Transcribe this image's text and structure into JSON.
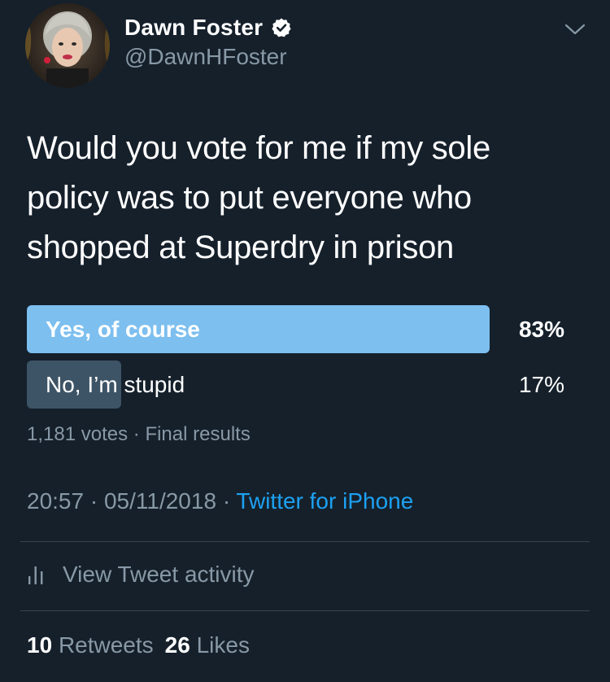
{
  "tweet": {
    "author": {
      "display_name": "Dawn Foster",
      "handle": "@DawnHFoster",
      "verified": true
    },
    "text": "Would you vote for me if my sole policy was to put everyone who shopped at Superdry in prison"
  },
  "poll": {
    "options": [
      {
        "label": "Yes, of course",
        "percent_text": "83%",
        "percent": 83,
        "winner": true
      },
      {
        "label": "No, I’m stupid",
        "percent_text": "17%",
        "percent": 17,
        "winner": false
      }
    ],
    "votes": "1,181 votes",
    "status": "Final results"
  },
  "meta": {
    "time": "20:57",
    "date": "05/11/2018",
    "source": "Twitter for iPhone",
    "separator": "·"
  },
  "activity": {
    "label": "View Tweet activity"
  },
  "stats": {
    "retweets_count": "10",
    "retweets_label": "Retweets",
    "likes_count": "26",
    "likes_label": "Likes"
  },
  "colors": {
    "background": "#15202b",
    "winner_bar": "#7dbfef",
    "loser_bar": "#3d5466",
    "link": "#1da1f2",
    "secondary_text": "#8899a6",
    "divider": "#38444d"
  }
}
